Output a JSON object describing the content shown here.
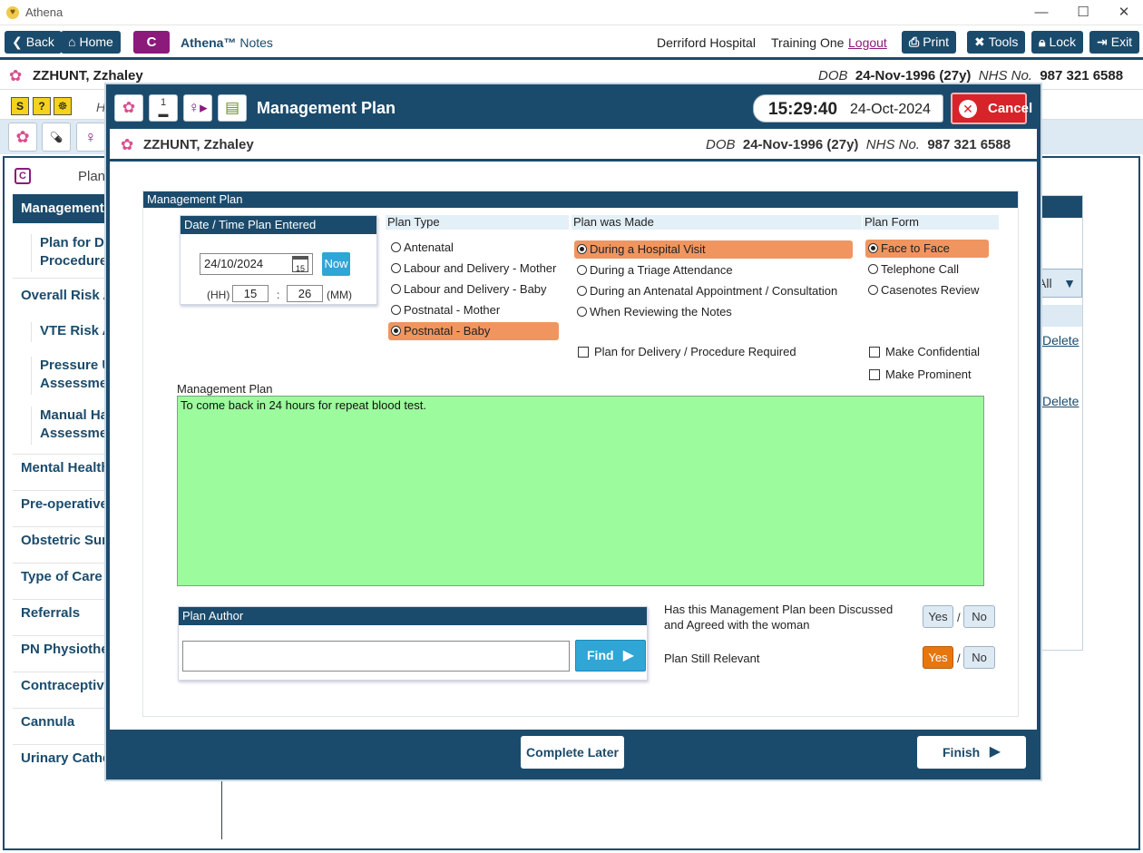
{
  "window": {
    "app_name": "Athena",
    "minimize": "—",
    "maximize": "☐",
    "close": "✕"
  },
  "toolbar": {
    "back": "Back",
    "home": "Home",
    "c_label": "C",
    "brand_name": "Athena™",
    "brand_suffix": "Notes",
    "hospital": "Derriford Hospital",
    "user": "Training One",
    "logout": "Logout",
    "print": "Print",
    "tools": "Tools",
    "lock": "Lock",
    "exit": "Exit"
  },
  "patient": {
    "name": "ZZHUNT, Zzhaley",
    "dob_label": "DOB",
    "dob": "24-Nov-1996 (27y)",
    "nhs_label": "NHS No.",
    "nhs": "987 321 6588"
  },
  "background": {
    "row1_letter": "H",
    "sidebar_c": "C",
    "sidebar_heading": "Plan",
    "selected": "Management",
    "items": [
      "Overall Risk A",
      "Mental Health",
      "Pre-operative",
      "Obstetric Surg",
      "Type of Care",
      "Referrals",
      "PN Physiother",
      "Contraceptive",
      "Cannula",
      "Urinary Cathe"
    ],
    "subitems": [
      {
        "line1": "Plan for De",
        "line2": "Procedure"
      },
      {
        "line1": "VTE Risk As",
        "line2": ""
      },
      {
        "line1": "Pressure Ul",
        "line2": "Assessmen"
      },
      {
        "line1": "Manual Ha",
        "line2": "Assessmen"
      }
    ],
    "filter_all": "All",
    "delete": "Delete"
  },
  "modal": {
    "icon_badge": "1",
    "title": "Management Plan",
    "time": "15:29:40",
    "date": "24-Oct-2024",
    "cancel": "Cancel",
    "panel_title": "Management Plan",
    "datetime": {
      "title": "Date / Time Plan Entered",
      "date": "24/10/2024",
      "cal_day": "15",
      "now": "Now",
      "hh_label": "(HH)",
      "hh": "15",
      "sep": ":",
      "mm": "26",
      "mm_label": "(MM)"
    },
    "plan_type": {
      "label": "Plan Type",
      "options": [
        "Antenatal",
        "Labour and Delivery - Mother",
        "Labour and Delivery - Baby",
        "Postnatal - Mother",
        "Postnatal - Baby"
      ],
      "selected": 4
    },
    "plan_made": {
      "label": "Plan was Made",
      "options": [
        "During a Hospital Visit",
        "During a Triage Attendance",
        "During an Antenatal Appointment / Consultation",
        "When Reviewing the Notes"
      ],
      "selected": 0
    },
    "plan_form": {
      "label": "Plan Form",
      "options": [
        "Face to Face",
        "Telephone Call",
        "Casenotes Review"
      ],
      "selected": 0
    },
    "checkboxes": {
      "delivery": "Plan for Delivery / Procedure Required",
      "confidential": "Make Confidential",
      "prominent": "Make Prominent"
    },
    "mp_label": "Management Plan",
    "mp_text": "To come back in 24 hours for repeat blood test.",
    "author": {
      "title": "Plan Author",
      "value": "",
      "find": "Find"
    },
    "discussed": {
      "question": "Has this Management Plan been Discussed and Agreed with the woman",
      "yes": "Yes",
      "no": "No",
      "slash": "/"
    },
    "relevant": {
      "question": "Plan Still Relevant",
      "yes": "Yes",
      "no": "No",
      "slash": "/"
    },
    "complete_later": "Complete Later",
    "finish": "Finish"
  }
}
